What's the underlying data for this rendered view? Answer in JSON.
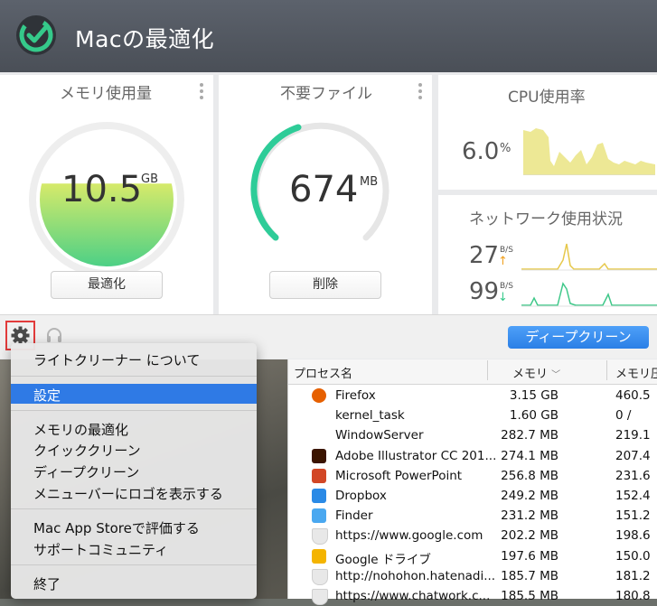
{
  "app": {
    "title": "Macの最適化"
  },
  "memory": {
    "title": "メモリ使用量",
    "value": "10.5",
    "unit": "GB",
    "button": "最適化",
    "fill_level": 0.62
  },
  "junk": {
    "title": "不要ファイル",
    "value": "674",
    "unit": "MB",
    "button": "削除"
  },
  "cpu": {
    "title": "CPU使用率",
    "value": "6.0",
    "unit": "%"
  },
  "network": {
    "title": "ネットワーク使用状況",
    "up_value": "27",
    "down_value": "99",
    "unit": "B/S"
  },
  "bottom": {
    "deep_clean": "ディープクリーン"
  },
  "menu": {
    "items": [
      {
        "label": "ライトクリーナー について"
      },
      {
        "label": "設定"
      },
      {
        "label": "メモリの最適化"
      },
      {
        "label": "クイッククリーン"
      },
      {
        "label": "ディープクリーン"
      },
      {
        "label": "メニューバーにロゴを表示する"
      },
      {
        "label": "Mac App Storeで評価する"
      },
      {
        "label": "サポートコミュニティ"
      },
      {
        "label": "終了"
      }
    ]
  },
  "process_table": {
    "headers": {
      "name": "プロセス名",
      "memory": "メモリ",
      "compressed": "メモリ圧"
    },
    "rows": [
      {
        "name": "Firefox",
        "memory": "3.15 GB",
        "compressed": "460.5",
        "icon": "firefox-icon",
        "color": "#e66000"
      },
      {
        "name": "kernel_task",
        "memory": "1.60 GB",
        "compressed": "0 /",
        "icon": "none",
        "color": "#ffffff"
      },
      {
        "name": "WindowServer",
        "memory": "282.7 MB",
        "compressed": "219.1",
        "icon": "none",
        "color": "#ffffff"
      },
      {
        "name": "Adobe Illustrator CC 201...",
        "memory": "274.1 MB",
        "compressed": "207.4",
        "icon": "illustrator-icon",
        "color": "#3a1400"
      },
      {
        "name": "Microsoft PowerPoint",
        "memory": "256.8 MB",
        "compressed": "231.6",
        "icon": "powerpoint-icon",
        "color": "#d24726"
      },
      {
        "name": "Dropbox",
        "memory": "249.2 MB",
        "compressed": "152.4",
        "icon": "dropbox-icon",
        "color": "#2a8ae6"
      },
      {
        "name": "Finder",
        "memory": "231.2 MB",
        "compressed": "151.2",
        "icon": "finder-icon",
        "color": "#4aa8f0"
      },
      {
        "name": "https://www.google.com",
        "memory": "202.2 MB",
        "compressed": "198.6",
        "icon": "shield-icon",
        "color": "#e8e8e8"
      },
      {
        "name": "Google ドライブ",
        "memory": "197.6 MB",
        "compressed": "150.0",
        "icon": "google-drive-icon",
        "color": "#f4b400"
      },
      {
        "name": "http://nohohon.hatenadi...",
        "memory": "185.7 MB",
        "compressed": "181.2",
        "icon": "shield-icon",
        "color": "#e8e8e8"
      },
      {
        "name": "https://www.chatwork.c...",
        "memory": "185.5 MB",
        "compressed": "180.8",
        "icon": "shield-icon",
        "color": "#e8e8e8"
      }
    ]
  }
}
